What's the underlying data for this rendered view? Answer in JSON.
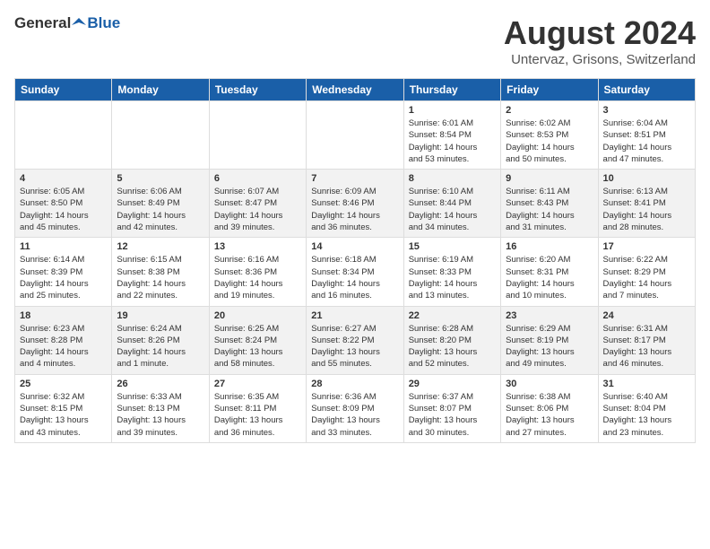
{
  "header": {
    "logo_general": "General",
    "logo_blue": "Blue",
    "main_title": "August 2024",
    "subtitle": "Untervaz, Grisons, Switzerland"
  },
  "calendar": {
    "days_of_week": [
      "Sunday",
      "Monday",
      "Tuesday",
      "Wednesday",
      "Thursday",
      "Friday",
      "Saturday"
    ],
    "weeks": [
      [
        {
          "day": "",
          "content": ""
        },
        {
          "day": "",
          "content": ""
        },
        {
          "day": "",
          "content": ""
        },
        {
          "day": "",
          "content": ""
        },
        {
          "day": "1",
          "content": "Sunrise: 6:01 AM\nSunset: 8:54 PM\nDaylight: 14 hours\nand 53 minutes."
        },
        {
          "day": "2",
          "content": "Sunrise: 6:02 AM\nSunset: 8:53 PM\nDaylight: 14 hours\nand 50 minutes."
        },
        {
          "day": "3",
          "content": "Sunrise: 6:04 AM\nSunset: 8:51 PM\nDaylight: 14 hours\nand 47 minutes."
        }
      ],
      [
        {
          "day": "4",
          "content": "Sunrise: 6:05 AM\nSunset: 8:50 PM\nDaylight: 14 hours\nand 45 minutes."
        },
        {
          "day": "5",
          "content": "Sunrise: 6:06 AM\nSunset: 8:49 PM\nDaylight: 14 hours\nand 42 minutes."
        },
        {
          "day": "6",
          "content": "Sunrise: 6:07 AM\nSunset: 8:47 PM\nDaylight: 14 hours\nand 39 minutes."
        },
        {
          "day": "7",
          "content": "Sunrise: 6:09 AM\nSunset: 8:46 PM\nDaylight: 14 hours\nand 36 minutes."
        },
        {
          "day": "8",
          "content": "Sunrise: 6:10 AM\nSunset: 8:44 PM\nDaylight: 14 hours\nand 34 minutes."
        },
        {
          "day": "9",
          "content": "Sunrise: 6:11 AM\nSunset: 8:43 PM\nDaylight: 14 hours\nand 31 minutes."
        },
        {
          "day": "10",
          "content": "Sunrise: 6:13 AM\nSunset: 8:41 PM\nDaylight: 14 hours\nand 28 minutes."
        }
      ],
      [
        {
          "day": "11",
          "content": "Sunrise: 6:14 AM\nSunset: 8:39 PM\nDaylight: 14 hours\nand 25 minutes."
        },
        {
          "day": "12",
          "content": "Sunrise: 6:15 AM\nSunset: 8:38 PM\nDaylight: 14 hours\nand 22 minutes."
        },
        {
          "day": "13",
          "content": "Sunrise: 6:16 AM\nSunset: 8:36 PM\nDaylight: 14 hours\nand 19 minutes."
        },
        {
          "day": "14",
          "content": "Sunrise: 6:18 AM\nSunset: 8:34 PM\nDaylight: 14 hours\nand 16 minutes."
        },
        {
          "day": "15",
          "content": "Sunrise: 6:19 AM\nSunset: 8:33 PM\nDaylight: 14 hours\nand 13 minutes."
        },
        {
          "day": "16",
          "content": "Sunrise: 6:20 AM\nSunset: 8:31 PM\nDaylight: 14 hours\nand 10 minutes."
        },
        {
          "day": "17",
          "content": "Sunrise: 6:22 AM\nSunset: 8:29 PM\nDaylight: 14 hours\nand 7 minutes."
        }
      ],
      [
        {
          "day": "18",
          "content": "Sunrise: 6:23 AM\nSunset: 8:28 PM\nDaylight: 14 hours\nand 4 minutes."
        },
        {
          "day": "19",
          "content": "Sunrise: 6:24 AM\nSunset: 8:26 PM\nDaylight: 14 hours\nand 1 minute."
        },
        {
          "day": "20",
          "content": "Sunrise: 6:25 AM\nSunset: 8:24 PM\nDaylight: 13 hours\nand 58 minutes."
        },
        {
          "day": "21",
          "content": "Sunrise: 6:27 AM\nSunset: 8:22 PM\nDaylight: 13 hours\nand 55 minutes."
        },
        {
          "day": "22",
          "content": "Sunrise: 6:28 AM\nSunset: 8:20 PM\nDaylight: 13 hours\nand 52 minutes."
        },
        {
          "day": "23",
          "content": "Sunrise: 6:29 AM\nSunset: 8:19 PM\nDaylight: 13 hours\nand 49 minutes."
        },
        {
          "day": "24",
          "content": "Sunrise: 6:31 AM\nSunset: 8:17 PM\nDaylight: 13 hours\nand 46 minutes."
        }
      ],
      [
        {
          "day": "25",
          "content": "Sunrise: 6:32 AM\nSunset: 8:15 PM\nDaylight: 13 hours\nand 43 minutes."
        },
        {
          "day": "26",
          "content": "Sunrise: 6:33 AM\nSunset: 8:13 PM\nDaylight: 13 hours\nand 39 minutes."
        },
        {
          "day": "27",
          "content": "Sunrise: 6:35 AM\nSunset: 8:11 PM\nDaylight: 13 hours\nand 36 minutes."
        },
        {
          "day": "28",
          "content": "Sunrise: 6:36 AM\nSunset: 8:09 PM\nDaylight: 13 hours\nand 33 minutes."
        },
        {
          "day": "29",
          "content": "Sunrise: 6:37 AM\nSunset: 8:07 PM\nDaylight: 13 hours\nand 30 minutes."
        },
        {
          "day": "30",
          "content": "Sunrise: 6:38 AM\nSunset: 8:06 PM\nDaylight: 13 hours\nand 27 minutes."
        },
        {
          "day": "31",
          "content": "Sunrise: 6:40 AM\nSunset: 8:04 PM\nDaylight: 13 hours\nand 23 minutes."
        }
      ]
    ]
  }
}
